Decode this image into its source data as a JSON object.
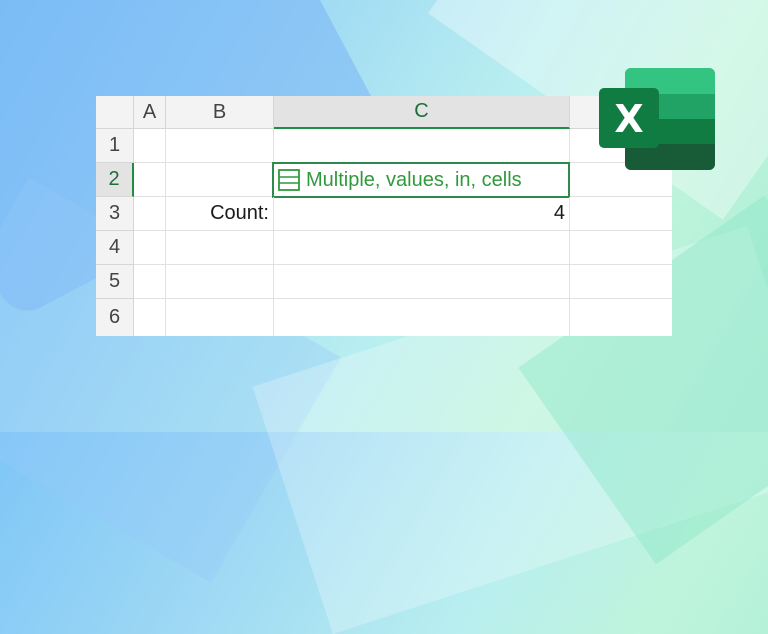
{
  "columns": [
    "A",
    "B",
    "C"
  ],
  "rows": [
    "1",
    "2",
    "3",
    "4",
    "5",
    "6"
  ],
  "cells": {
    "C2": "Multiple, values, in, cells",
    "B3": "Count:",
    "C3": "4"
  },
  "logo": {
    "letter": "X"
  },
  "colors": {
    "accent": "#2e8b4e",
    "excel_green": "#1d6f42"
  }
}
